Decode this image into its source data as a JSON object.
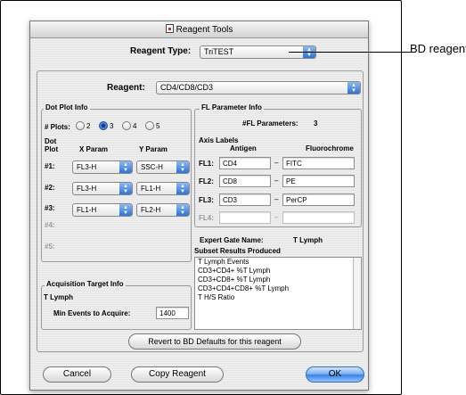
{
  "window": {
    "title": "Reagent Tools",
    "reagent_type_label": "Reagent Type:",
    "reagent_type_value": "TriTEST",
    "reagent_label": "Reagent:",
    "reagent_value": "CD4/CD8/CD3"
  },
  "callout": {
    "text": "BD reagent"
  },
  "dot_plot": {
    "title": "Dot Plot Info",
    "plots_label": "# Plots:",
    "plot_options": [
      "2",
      "3",
      "4",
      "5"
    ],
    "selected_plots": "3",
    "col_dot_plot_1": "Dot",
    "col_dot_plot_2": "Plot",
    "col_x": "X Param",
    "col_y": "Y Param",
    "rows": [
      {
        "label": "#1:",
        "x": "FL3-H",
        "y": "SSC-H",
        "enabled": true
      },
      {
        "label": "#2:",
        "x": "FL3-H",
        "y": "FL1-H",
        "enabled": true
      },
      {
        "label": "#3:",
        "x": "FL1-H",
        "y": "FL2-H",
        "enabled": true
      },
      {
        "label": "#4:",
        "x": "",
        "y": "",
        "enabled": false
      },
      {
        "label": "#5:",
        "x": "",
        "y": "",
        "enabled": false
      }
    ]
  },
  "fl_param": {
    "title": "FL Parameter Info",
    "count_label": "#FL Parameters:",
    "count_value": "3",
    "axis_labels": "Axis Labels",
    "col_antigen": "Antigen",
    "col_fluoro": "Fluorochrome",
    "rows": [
      {
        "label": "FL1:",
        "antigen": "CD4",
        "fluoro": "FITC",
        "enabled": true
      },
      {
        "label": "FL2:",
        "antigen": "CD8",
        "fluoro": "PE",
        "enabled": true
      },
      {
        "label": "FL3:",
        "antigen": "CD3",
        "fluoro": "PerCP",
        "enabled": true
      },
      {
        "label": "FL4:",
        "antigen": "",
        "fluoro": "",
        "enabled": false
      }
    ],
    "dash": "–"
  },
  "gate": {
    "expert_label": "Expert Gate Name:",
    "expert_value": "T Lymph",
    "subset_label": "Subset Results Produced",
    "subsets": [
      "T Lymph Events",
      "CD3+CD4+ %T Lymph",
      "CD3+CD8+ %T Lymph",
      "CD3+CD4+CD8+ %T Lymph",
      "T H/S Ratio"
    ]
  },
  "acquisition": {
    "title": "Acquisition Target Info",
    "gate": "T Lymph",
    "min_events_label": "Min Events to Acquire:",
    "min_events_value": "1400"
  },
  "buttons": {
    "revert": "Revert to BD Defaults for this reagent",
    "cancel": "Cancel",
    "copy": "Copy Reagent",
    "ok": "OK"
  }
}
